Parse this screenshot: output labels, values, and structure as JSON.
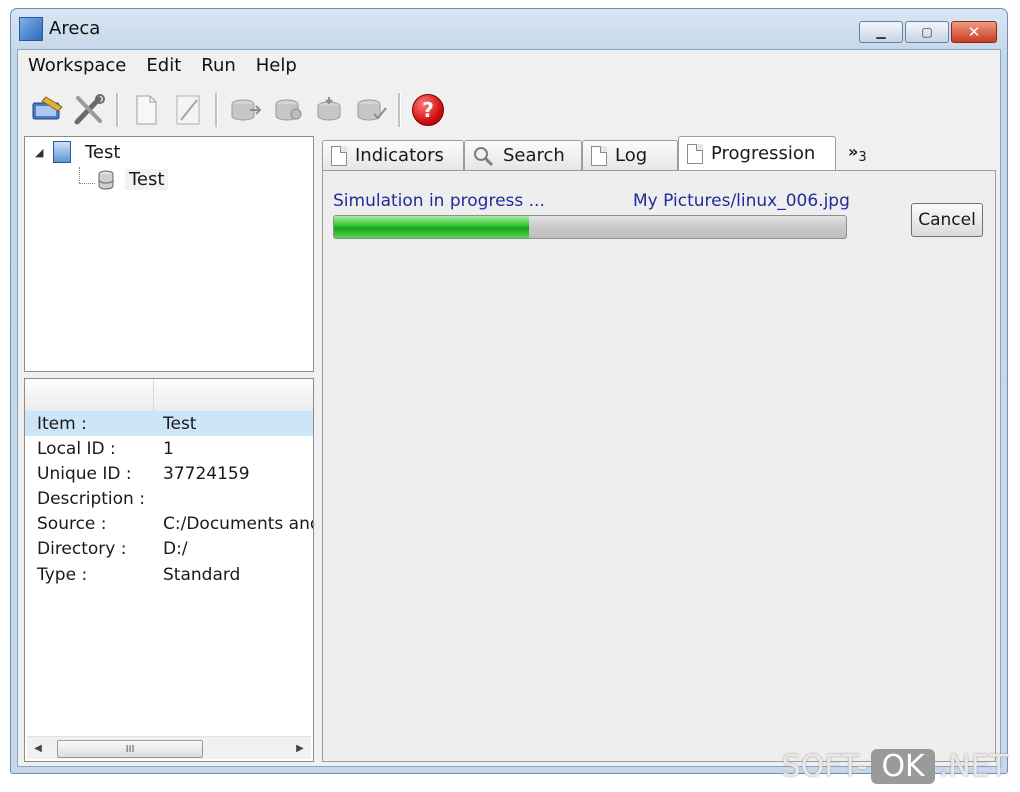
{
  "window": {
    "title": "Areca"
  },
  "menu": [
    "Workspace",
    "Edit",
    "Run",
    "Help"
  ],
  "toolbar": {
    "icons": [
      "workspace-icon",
      "tools-icon",
      "new-page-icon",
      "edit-icon",
      "backup-icon",
      "merge-icon",
      "recover-icon",
      "check-icon",
      "help-icon"
    ],
    "help_glyph": "?"
  },
  "tree": {
    "root": {
      "label": "Test",
      "icon": "workspace-icon"
    },
    "child": {
      "label": "Test",
      "icon": "database-icon"
    }
  },
  "properties": [
    {
      "key": "Item :",
      "value": "Test"
    },
    {
      "key": "Local ID :",
      "value": "1"
    },
    {
      "key": "Unique ID :",
      "value": "37724159"
    },
    {
      "key": "Description :",
      "value": ""
    },
    {
      "key": "Source :",
      "value": "C:/Documents and"
    },
    {
      "key": "Directory :",
      "value": "D:/"
    },
    {
      "key": "Type :",
      "value": "Standard"
    }
  ],
  "scrollbar": {
    "thumb_glyph": "III"
  },
  "tabs": [
    {
      "label": "Indicators",
      "icon": "page-icon"
    },
    {
      "label": "Search",
      "icon": "search-icon"
    },
    {
      "label": "Log",
      "icon": "page-icon"
    },
    {
      "label": "Progression",
      "icon": "page-icon",
      "active": true
    }
  ],
  "tab_overflow": {
    "glyph": "»",
    "count": "3"
  },
  "progression": {
    "status": "Simulation in progress ...",
    "current_file": "My Pictures/linux_006.jpg",
    "progress": 0.38,
    "cancel_label": "Cancel"
  },
  "watermark": {
    "left": "SOFT-",
    "box": "OK",
    "right": ".NET"
  },
  "colors": {
    "progress": "#2ec22e",
    "status_text": "#1f2c9a",
    "selection": "#cce6f8"
  }
}
